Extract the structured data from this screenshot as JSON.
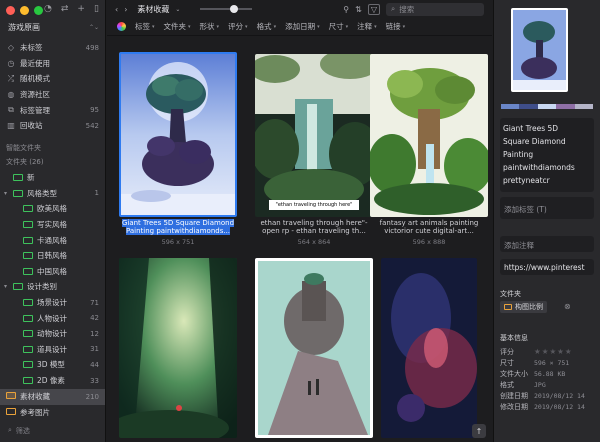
{
  "window": {
    "traffic_colors": [
      "#ff5f57",
      "#febc2e",
      "#28c840"
    ]
  },
  "sidebar": {
    "library_name": "游戏原画",
    "top_items": [
      {
        "label": "未标签",
        "count": "498",
        "icon": "tag-icon"
      },
      {
        "label": "最近使用",
        "count": "",
        "icon": "clock-icon"
      },
      {
        "label": "随机模式",
        "count": "",
        "icon": "shuffle-icon"
      },
      {
        "label": "资源社区",
        "count": "",
        "icon": "community-icon"
      },
      {
        "label": "标签管理",
        "count": "95",
        "icon": "tags-icon"
      },
      {
        "label": "回收站",
        "count": "542",
        "icon": "trash-icon"
      }
    ],
    "smart_folders_label": "智能文件夹",
    "folders_label": "文件夹 (26)",
    "folders": [
      {
        "label": "新",
        "count": "",
        "level": 0,
        "caret": ""
      },
      {
        "label": "风格类型",
        "count": "1",
        "level": 0,
        "caret": "▾"
      },
      {
        "label": "欧美风格",
        "count": "",
        "level": 1,
        "caret": ""
      },
      {
        "label": "写实风格",
        "count": "",
        "level": 1,
        "caret": ""
      },
      {
        "label": "卡通风格",
        "count": "",
        "level": 1,
        "caret": ""
      },
      {
        "label": "日韩风格",
        "count": "",
        "level": 1,
        "caret": ""
      },
      {
        "label": "中国风格",
        "count": "",
        "level": 1,
        "caret": ""
      },
      {
        "label": "设计类别",
        "count": "",
        "level": 0,
        "caret": "▾"
      },
      {
        "label": "场景设计",
        "count": "71",
        "level": 1,
        "caret": ""
      },
      {
        "label": "人物设计",
        "count": "42",
        "level": 1,
        "caret": ""
      },
      {
        "label": "动物设计",
        "count": "12",
        "level": 1,
        "caret": ""
      },
      {
        "label": "道具设计",
        "count": "31",
        "level": 1,
        "caret": ""
      },
      {
        "label": "3D 模型",
        "count": "44",
        "level": 1,
        "caret": ""
      },
      {
        "label": "2D 像素",
        "count": "33",
        "level": 1,
        "caret": ""
      }
    ],
    "bottom_items": [
      {
        "label": "素材收藏",
        "count": "210",
        "active": true
      },
      {
        "label": "参考图片",
        "count": "",
        "active": false
      }
    ],
    "filter_placeholder": "筛选"
  },
  "toolbar": {
    "title": "素材收藏",
    "search_placeholder": "搜索"
  },
  "filterbar": {
    "items": [
      "标签",
      "文件夹",
      "形状",
      "评分",
      "格式",
      "添加日期",
      "尺寸",
      "注释",
      "链接"
    ]
  },
  "grid": {
    "items": [
      {
        "caption": "Giant Trees 5D Square Diamond Painting paintwithdiamonds...",
        "dims": "596 x 751",
        "selected": true
      },
      {
        "caption": "ethan traveling through here\"-open rp - ethan traveling th...",
        "dims": "564 x 864",
        "selected": false,
        "overlay_text": "\"ethan traveling through here\""
      },
      {
        "caption": "fantasy art animals painting victorior cute digital-art...",
        "dims": "596 x 888",
        "selected": false
      },
      {
        "caption": "",
        "dims": "",
        "selected": false
      },
      {
        "caption": "",
        "dims": "",
        "selected": false
      },
      {
        "caption": "",
        "dims": "",
        "selected": false
      }
    ]
  },
  "inspector": {
    "palette": [
      "#6a86c8",
      "#3f4e8a",
      "#c9d8f2",
      "#8f6fa6",
      "#b4b4c8"
    ],
    "name_lines": [
      "Giant Trees 5D",
      "Square Diamond",
      "Painting",
      "paintwithdiamonds",
      "prettyneatcr"
    ],
    "tags_placeholder": "添加标签 (T)",
    "notes_placeholder": "添加注释",
    "url": "https://www.pinterest",
    "folder_header": "文件夹",
    "folder_chip": "构图比例",
    "basic_header": "基本信息",
    "props": [
      {
        "key": "评分",
        "value": ""
      },
      {
        "key": "尺寸",
        "value": "596 × 751"
      },
      {
        "key": "文件大小",
        "value": "56.88 KB"
      },
      {
        "key": "格式",
        "value": "JPG"
      },
      {
        "key": "创建日期",
        "value": "2019/08/12 14"
      },
      {
        "key": "修改日期",
        "value": "2019/08/12 14"
      }
    ]
  }
}
